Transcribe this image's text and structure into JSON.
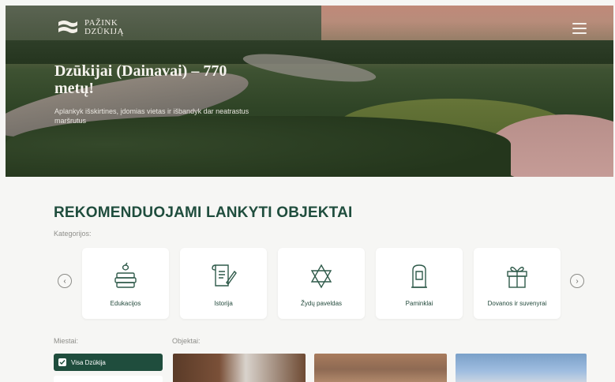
{
  "brand": {
    "line1": "PAŽINK",
    "line2": "DZŪKIJĄ"
  },
  "hero": {
    "title": "Dzūkijai (Dainavai) – 770 metų!",
    "subtitle": "Aplankyk išskirtines, įdomias vietas ir išbandyk dar neatrastus maršrutus"
  },
  "section": {
    "title": "REKOMENDUOJAMI LANKYTI OBJEKTAI",
    "categories_label": "Kategorijos:",
    "categories": [
      {
        "label": "Edukacijos",
        "icon": "books-apple-icon"
      },
      {
        "label": "Istorija",
        "icon": "scroll-quill-icon"
      },
      {
        "label": "Žydų paveldas",
        "icon": "star-of-david-icon"
      },
      {
        "label": "Paminklai",
        "icon": "monument-icon"
      },
      {
        "label": "Dovanos ir suvenyrai",
        "icon": "gift-icon"
      }
    ],
    "cities_label": "Miestai:",
    "objects_label": "Objektai:",
    "city_selected": "Visa Dzūkija"
  },
  "colors": {
    "accent": "#1f4d3d",
    "background": "#f6f6f4",
    "card": "#ffffff"
  }
}
